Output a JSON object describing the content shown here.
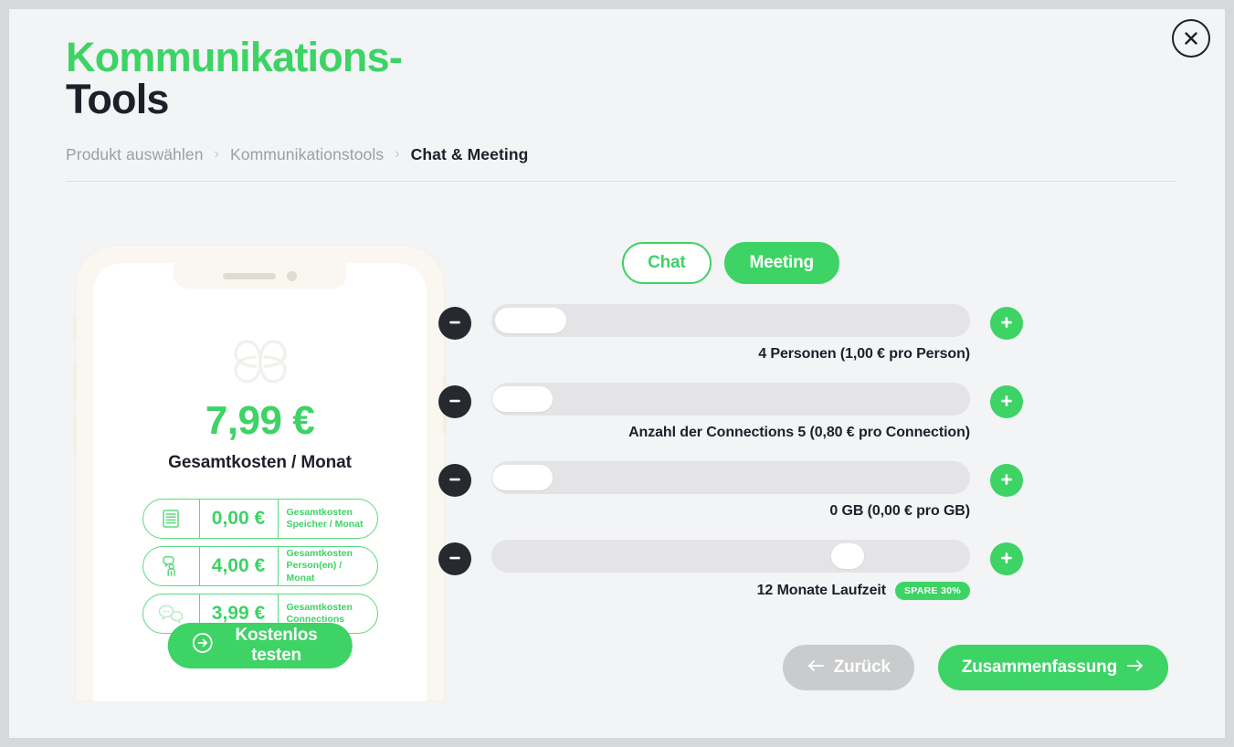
{
  "window": {
    "close_icon": "close-circle-icon"
  },
  "header": {
    "title_accent": "Kommunikations-",
    "title_rest": "Tools",
    "breadcrumb": [
      {
        "label": "Produkt auswählen",
        "active": false
      },
      {
        "label": "Kommunikationstools",
        "active": false
      },
      {
        "label": "Chat & Meeting",
        "active": true
      }
    ],
    "separator": "›"
  },
  "phone_preview": {
    "watermark_icon": "clover-logo-icon",
    "price_total": "7,99 €",
    "price_caption": "Gesamtkosten / Monat",
    "cost_rows": [
      {
        "icon": "server-storage-icon",
        "value": "0,00 €",
        "label_line1": "Gesamtkosten",
        "label_line2": "Speicher / Monat"
      },
      {
        "icon": "person-speech-icon",
        "value": "4,00 €",
        "label_line1": "Gesamtkosten",
        "label_line2": "Person(en) / Monat"
      },
      {
        "icon": "chat-bubbles-icon",
        "value": "3,99 €",
        "label_line1": "Gesamtkosten",
        "label_line2": "Connections"
      }
    ],
    "trial_button": {
      "label": "Kostenlos testen",
      "icon": "arrow-right-circle-icon"
    }
  },
  "config": {
    "mode_tabs": [
      {
        "label": "Chat",
        "selected": false
      },
      {
        "label": "Meeting",
        "selected": true
      }
    ],
    "sliders": [
      {
        "name": "persons",
        "caption": "4 Personen (1,00 € pro Person)",
        "thumb_percent": 1,
        "thumb_width": 78,
        "minus_icon": "minus-circle-icon",
        "plus_icon": "plus-circle-icon"
      },
      {
        "name": "connections",
        "caption": "Anzahl der Connections 5 (0,80 € pro Connection)",
        "thumb_percent": 0,
        "thumb_width": 66,
        "minus_icon": "minus-circle-icon",
        "plus_icon": "plus-circle-icon"
      },
      {
        "name": "storage",
        "caption": "0 GB (0,00 € pro GB)",
        "thumb_percent": 0,
        "thumb_width": 66,
        "minus_icon": "minus-circle-icon",
        "plus_icon": "plus-circle-icon"
      },
      {
        "name": "term",
        "caption": "12 Monate Laufzeit",
        "badge": "SPARE 30%",
        "thumb_percent": 71,
        "thumb_width": 36,
        "minus_icon": "minus-circle-icon",
        "plus_icon": "plus-circle-icon"
      }
    ]
  },
  "footer": {
    "back_button": {
      "label": "Zurück",
      "icon": "arrow-left-icon"
    },
    "next_button": {
      "label": "Zusammenfassung",
      "icon": "arrow-right-icon"
    }
  },
  "colors": {
    "brand_green": "#3dd365",
    "dark": "#1d2029",
    "muted": "#9aa0a6",
    "track": "#e4e4e6",
    "panel_bg": "#f2f4f6",
    "phone_bezel": "#faf7f1"
  }
}
